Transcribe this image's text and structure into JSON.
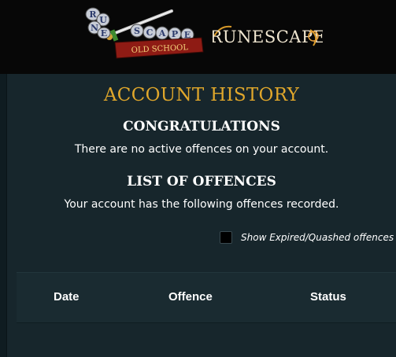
{
  "header": {
    "osrs_logo_text": "RuneScape Old School",
    "rs_logo_text": "RuneScape"
  },
  "page": {
    "title": "ACCOUNT HISTORY",
    "congrats_heading": "CONGRATULATIONS",
    "congrats_text": "There are no active offences on your account.",
    "list_heading": "LIST OF OFFENCES",
    "list_text": "Your account has the following offences recorded."
  },
  "filter": {
    "checkbox_label": "Show Expired/Quashed offences",
    "checked": false
  },
  "table": {
    "columns": [
      "Date",
      "Offence",
      "Status"
    ]
  },
  "colors": {
    "background": "#16262c",
    "header": "#070707",
    "title_gold": "#e0a72b"
  }
}
